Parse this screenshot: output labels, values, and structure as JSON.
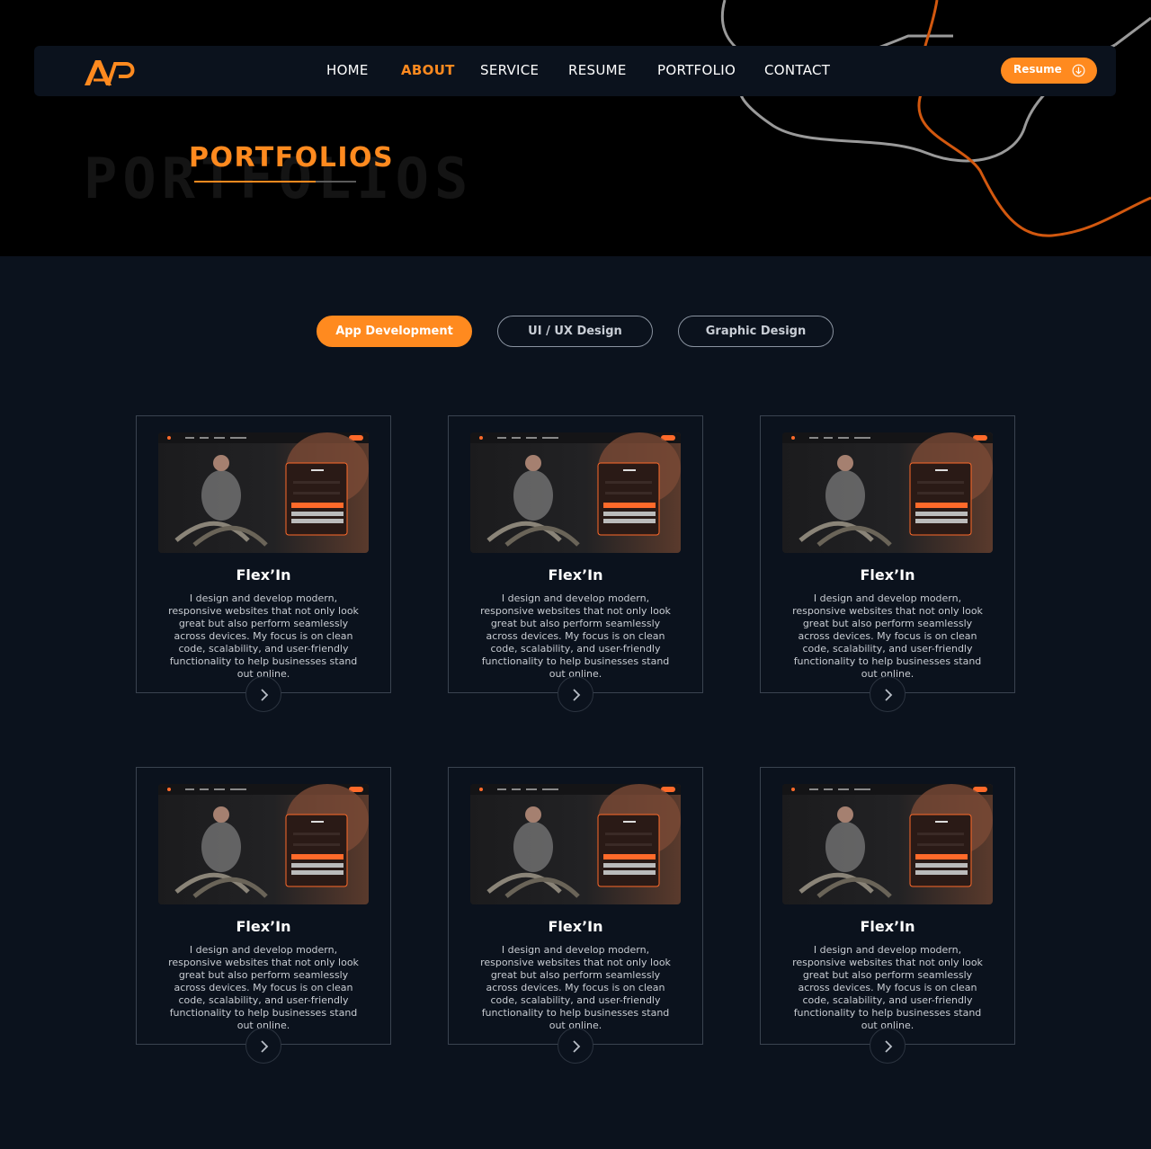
{
  "brand": {
    "logo_alt": "AP logo",
    "accent": "#ff8a1f",
    "background": "#0b121d"
  },
  "nav": {
    "items": [
      {
        "label": "HOME",
        "active": false
      },
      {
        "label": "ABOUT",
        "active": true
      },
      {
        "label": "SERVICE",
        "active": false
      },
      {
        "label": "RESUME",
        "active": false
      },
      {
        "label": "PORTFOLIO",
        "active": false
      },
      {
        "label": "CONTACT",
        "active": false
      }
    ],
    "resume_button": {
      "label": "Resume",
      "icon": "download-icon"
    }
  },
  "hero": {
    "title": "PORTFOLIOS",
    "ghost_text": "PORTFOLIOS"
  },
  "filters": [
    {
      "label": "App Development",
      "active": true
    },
    {
      "label": "UI / UX Design",
      "active": false
    },
    {
      "label": "Graphic Design",
      "active": false
    }
  ],
  "portfolio": [
    {
      "title": "Flex’In",
      "description": "I design and develop modern, responsive websites that not only look great but also perform seamlessly across devices. My focus is on clean code, scalability, and user-friendly functionality to help businesses stand out online.",
      "arrow_icon": "chevron-right-icon"
    },
    {
      "title": "Flex’In",
      "description": "I design and develop modern, responsive websites that not only look great but also perform seamlessly across devices. My focus is on clean code, scalability, and user-friendly functionality to help businesses stand out online.",
      "arrow_icon": "chevron-right-icon"
    },
    {
      "title": "Flex’In",
      "description": "I design and develop modern, responsive websites that not only look great but also perform seamlessly across devices. My focus is on clean code, scalability, and user-friendly functionality to help businesses stand out online.",
      "arrow_icon": "chevron-right-icon"
    },
    {
      "title": "Flex’In",
      "description": "I design and develop modern, responsive websites that not only look great but also perform seamlessly across devices. My focus is on clean code, scalability, and user-friendly functionality to help businesses stand out online.",
      "arrow_icon": "chevron-right-icon"
    },
    {
      "title": "Flex’In",
      "description": "I design and develop modern, responsive websites that not only look great but also perform seamlessly across devices. My focus is on clean code, scalability, and user-friendly functionality to help businesses stand out online.",
      "arrow_icon": "chevron-right-icon"
    },
    {
      "title": "Flex’In",
      "description": "I design and develop modern, responsive websites that not only look great but also perform seamlessly across devices. My focus is on clean code, scalability, and user-friendly functionality to help businesses stand out online.",
      "arrow_icon": "chevron-right-icon"
    }
  ]
}
